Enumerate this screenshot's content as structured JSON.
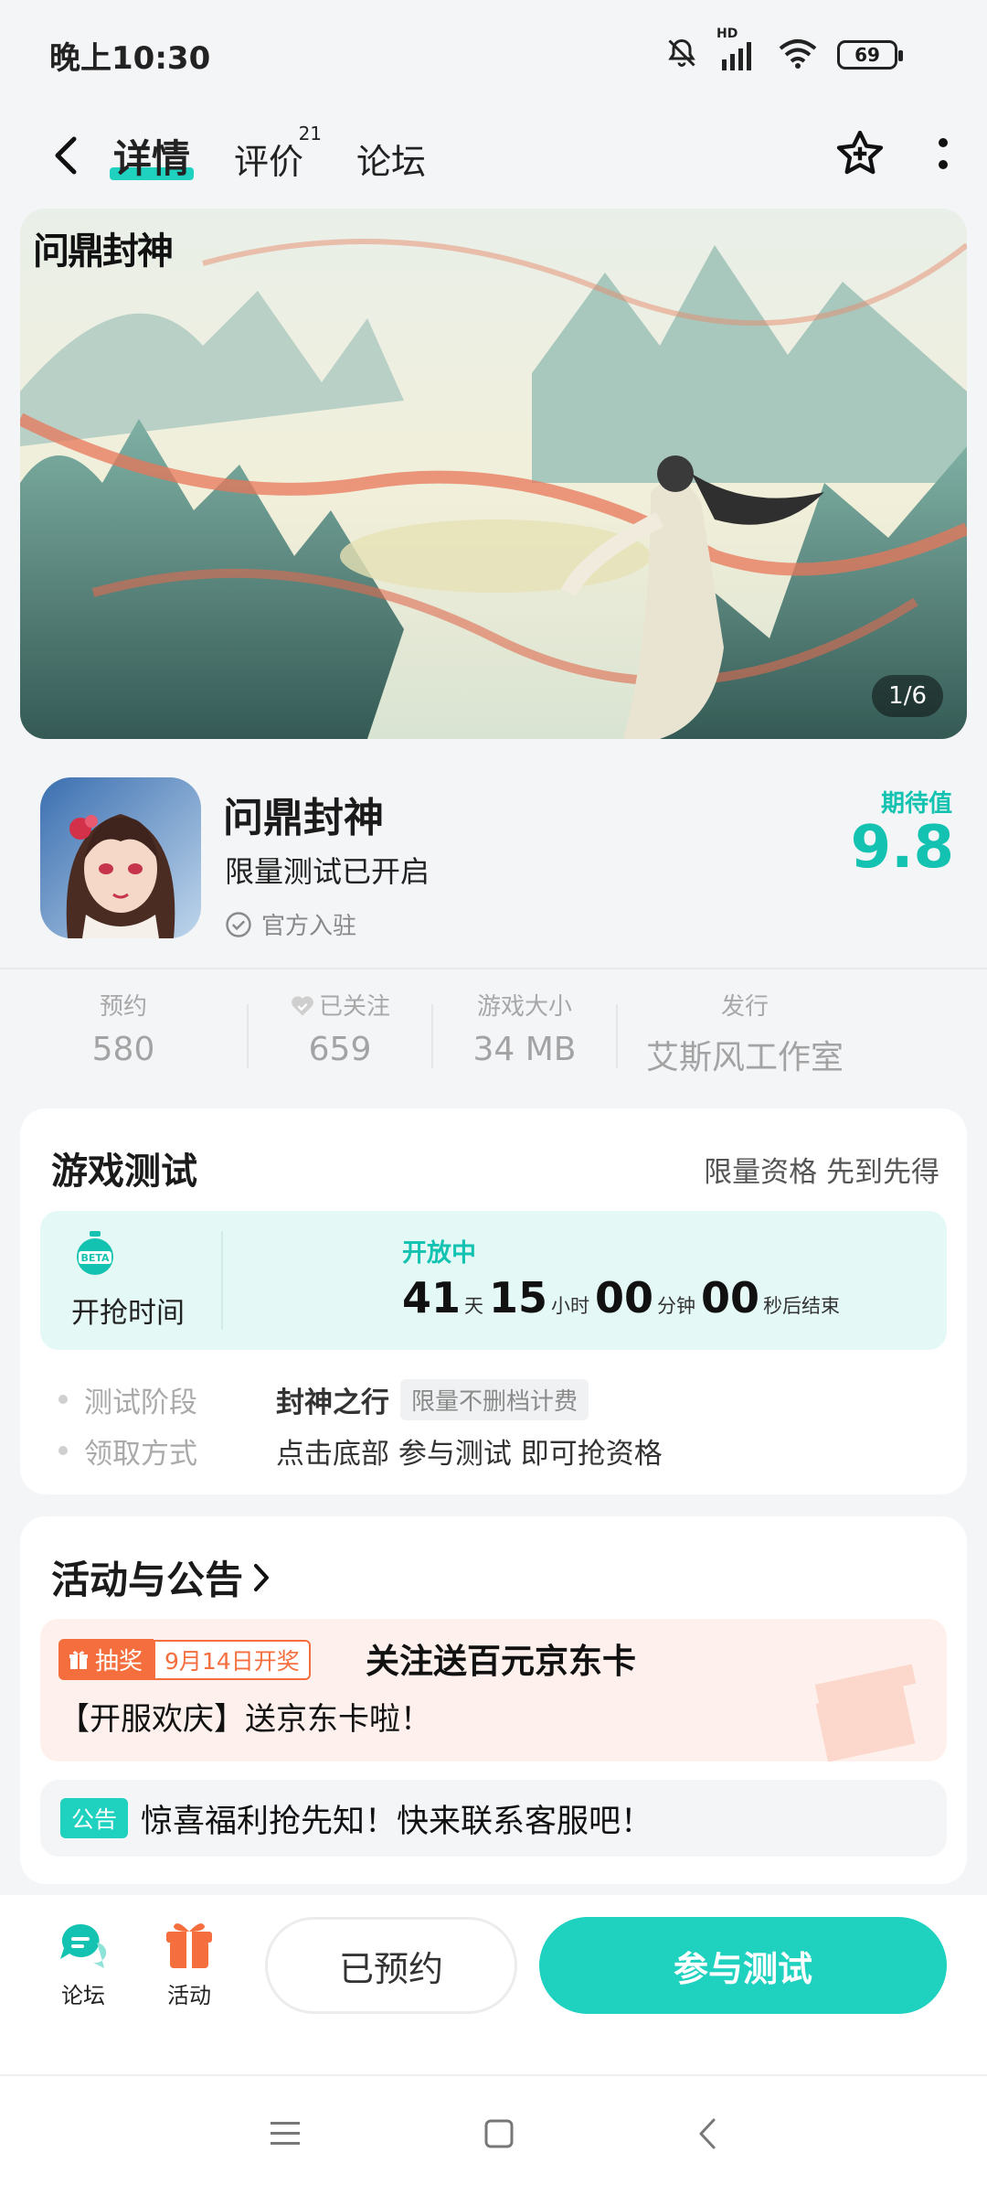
{
  "status_bar": {
    "time": "晚上10:30",
    "battery": "69",
    "network": "HD"
  },
  "nav": {
    "tabs": [
      {
        "label": "详情",
        "active": true
      },
      {
        "label": "评价",
        "badge": "21"
      },
      {
        "label": "论坛"
      }
    ]
  },
  "banner": {
    "logo_text": "问鼎封神",
    "page_indicator": "1/6"
  },
  "game": {
    "title": "问鼎封神",
    "subtitle": "限量测试已开启",
    "official_label": "官方入驻",
    "expect_label": "期待值",
    "expect_score": "9.8"
  },
  "stats": [
    {
      "label": "预约",
      "value": "580"
    },
    {
      "label": "已关注",
      "value": "659"
    },
    {
      "label": "游戏大小",
      "value": "34 MB"
    },
    {
      "label": "发行",
      "value": "艾斯风工作室"
    }
  ],
  "test": {
    "title": "游戏测试",
    "right_text": "限量资格 先到先得",
    "beta_badge": "BETA",
    "grab_label": "开抢时间",
    "open_status": "开放中",
    "countdown": {
      "days": "41",
      "days_unit": "天",
      "hours": "15",
      "hours_unit": "小时",
      "minutes": "00",
      "minutes_unit": "分钟",
      "seconds": "00",
      "seconds_unit": "秒后结束"
    },
    "rows": [
      {
        "key": "测试阶段",
        "value": "封神之行",
        "tag": "限量不删档计费"
      },
      {
        "key": "领取方式",
        "value": "点击底部 参与测试 即可抢资格"
      }
    ]
  },
  "news": {
    "title": "活动与公告",
    "item1": {
      "tag": "抽奖",
      "date_tag": "9月14日开奖",
      "headline": "关注送百元京东卡",
      "body": "【开服欢庆】送京东卡啦！"
    },
    "item2": {
      "tag": "公告",
      "text": "惊喜福利抢先知！快来联系客服吧！"
    }
  },
  "action_bar": {
    "forum_label": "论坛",
    "activity_label": "活动",
    "reserved_button": "已预约",
    "join_button": "参与测试"
  },
  "colors": {
    "accent": "#1fd1bf",
    "accent_text": "#13c2b0",
    "lottery": "#f56f3e"
  }
}
